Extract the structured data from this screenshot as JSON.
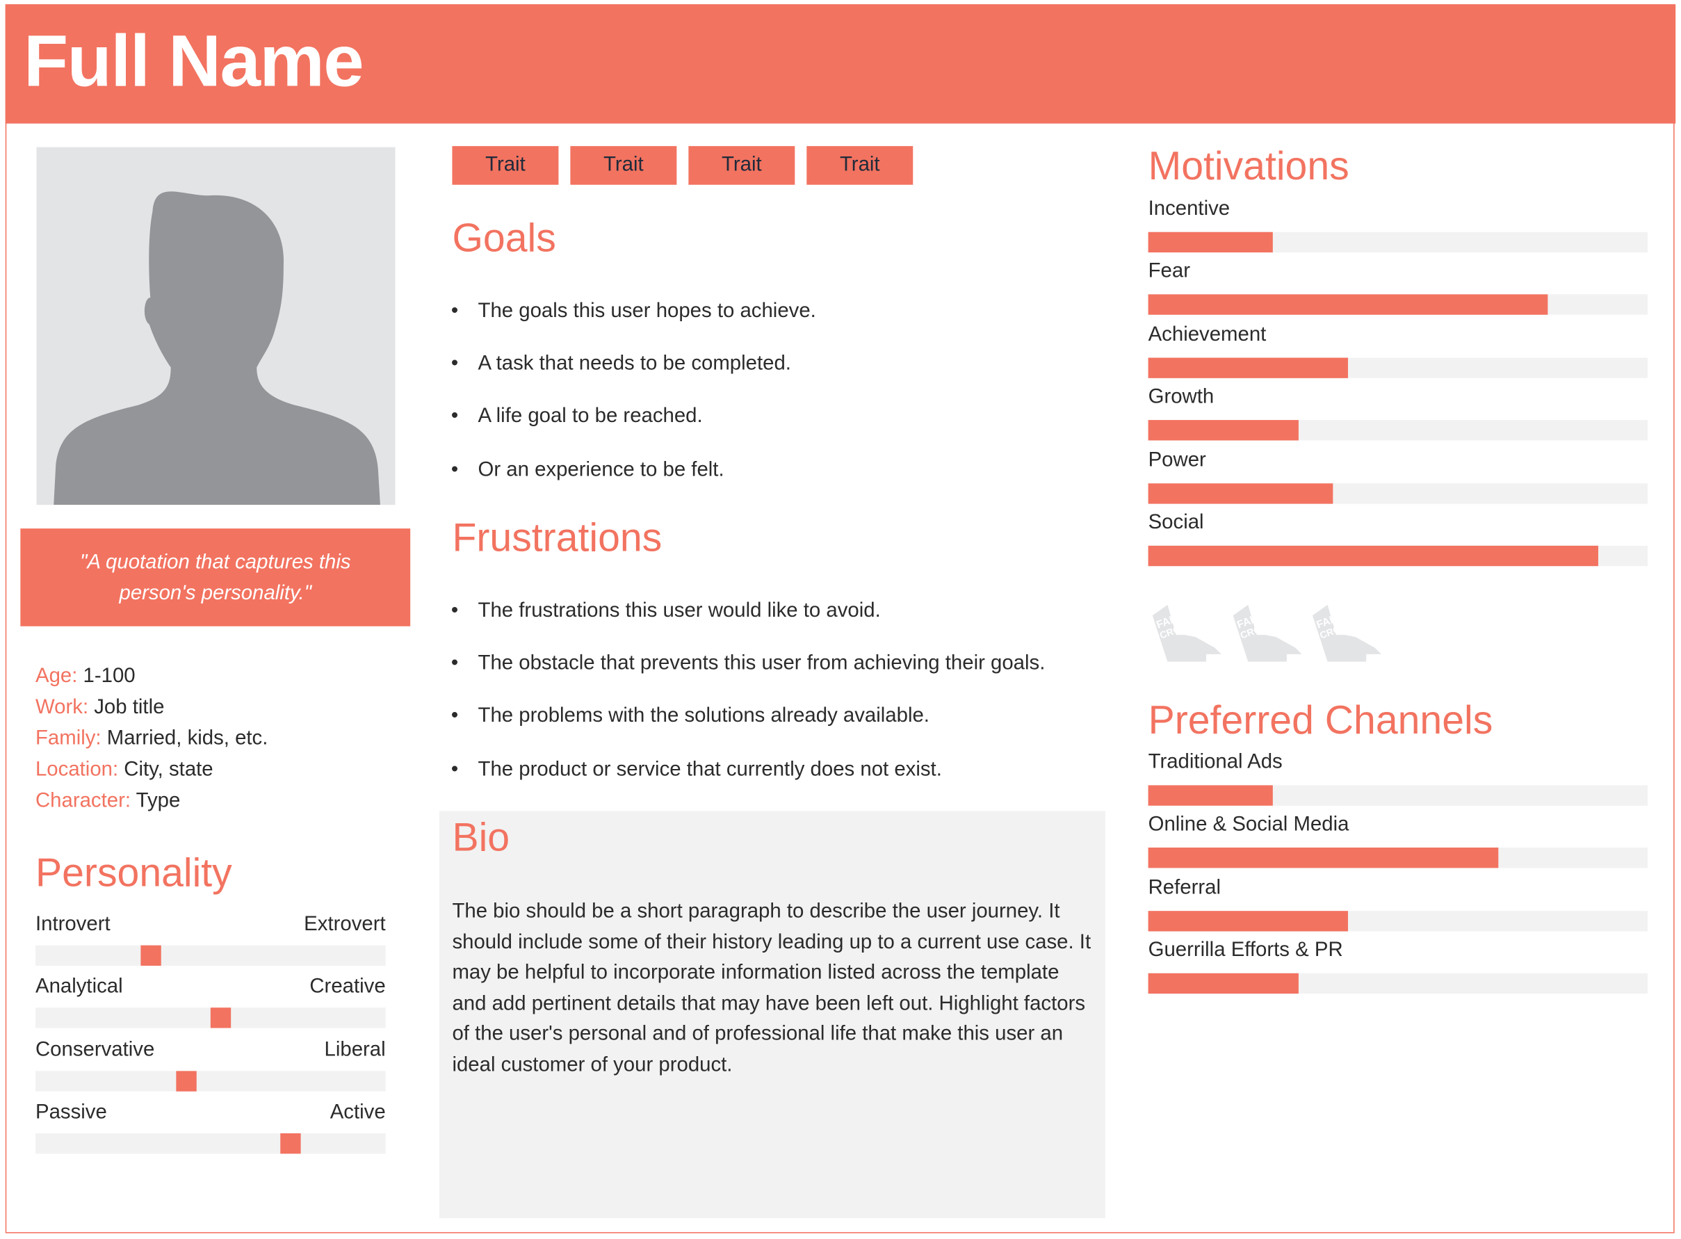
{
  "header": {
    "full_name": "Full Name"
  },
  "photo": {
    "icon": "person-silhouette-icon"
  },
  "quote": "\"A quotation that captures this person's personality.\"",
  "details": [
    {
      "label": "Age:",
      "value": "1-100"
    },
    {
      "label": "Work:",
      "value": "Job title"
    },
    {
      "label": "Family:",
      "value": "Married, kids, etc."
    },
    {
      "label": "Location:",
      "value": "City, state"
    },
    {
      "label": "Character:",
      "value": "Type"
    }
  ],
  "personality": {
    "title": "Personality",
    "scales": [
      {
        "left": "Introvert",
        "right": "Extrovert",
        "position": 0.33
      },
      {
        "left": "Analytical",
        "right": "Creative",
        "position": 0.53
      },
      {
        "left": "Conservative",
        "right": "Liberal",
        "position": 0.43
      },
      {
        "left": "Passive",
        "right": "Active",
        "position": 0.73
      }
    ]
  },
  "traits": [
    "Trait",
    "Trait",
    "Trait",
    "Trait"
  ],
  "goals": {
    "title": "Goals",
    "items": [
      "The goals this user hopes to achieve.",
      "A task that needs to be completed.",
      "A life goal to be reached.",
      "Or an experience to be felt."
    ]
  },
  "frustrations": {
    "title": "Frustrations",
    "items": [
      "The frustrations this user would like to avoid.",
      "The obstacle that prevents this user from achieving their goals.",
      "The problems with the solutions already available.",
      "The product or service that currently does not exist."
    ]
  },
  "bio": {
    "title": "Bio",
    "text": "The bio should be a short paragraph to describe the user journey. It should include some of their history leading up to a current use case. It may be helpful to incorporate information listed across the template and add pertinent details that may have been left out. Highlight factors of the user's personal and of professional life that make this user an ideal customer of your product."
  },
  "motivations": {
    "title": "Motivations",
    "items": [
      {
        "label": "Incentive",
        "value": 0.25
      },
      {
        "label": "Fear",
        "value": 0.8
      },
      {
        "label": "Achievement",
        "value": 0.4
      },
      {
        "label": "Growth",
        "value": 0.3
      },
      {
        "label": "Power",
        "value": 0.37
      },
      {
        "label": "Social",
        "value": 0.9
      }
    ]
  },
  "logos": {
    "text": "FAKE CROW",
    "count": 3
  },
  "channels": {
    "title": "Preferred Channels",
    "items": [
      {
        "label": "Traditional Ads",
        "value": 0.25
      },
      {
        "label": "Online & Social Media",
        "value": 0.7
      },
      {
        "label": "Referral",
        "value": 0.4
      },
      {
        "label": "Guerrilla Efforts & PR",
        "value": 0.3
      }
    ]
  },
  "colors": {
    "accent": "#F27360",
    "track": "#F2F2F2",
    "photo_bg": "#E3E4E6",
    "silhouette": "#939598"
  }
}
